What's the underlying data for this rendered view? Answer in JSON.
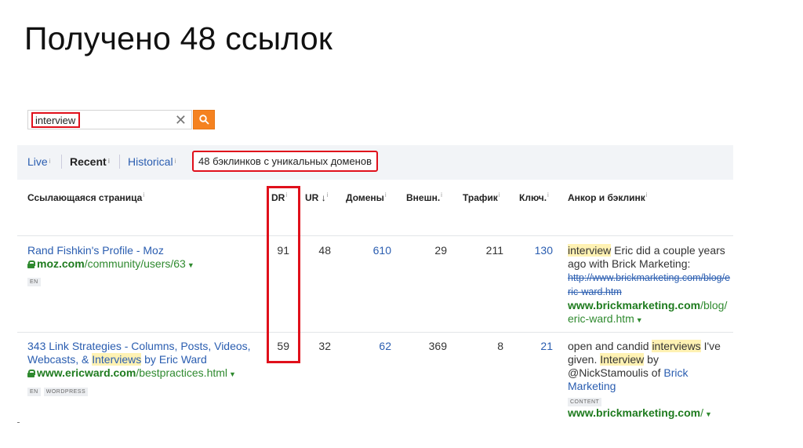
{
  "slide": {
    "title": "Получено 48 ссылок"
  },
  "search": {
    "value": "interview",
    "clear_glyph": "✕"
  },
  "tabs": [
    {
      "label": "Live",
      "info": "i"
    },
    {
      "label": "Recent",
      "info": "i"
    },
    {
      "label": "Historical",
      "info": "i"
    }
  ],
  "summary": {
    "text": "48 бэклинков с уникальных доменов"
  },
  "columns": {
    "page": "Ссылающаяся страница",
    "dr": "DR",
    "ur": "UR",
    "domains": "Домены",
    "ext": "Внешн.",
    "traffic": "Трафик",
    "keywords": "Ключ.",
    "anchor": "Анкор и бэклинк",
    "info": "i"
  },
  "rows": [
    {
      "title": "Rand Fishkin's Profile - Moz",
      "url_domain": "moz.com",
      "url_path": "/community/users/63",
      "tags": [
        "EN"
      ],
      "dr": "91",
      "ur": "48",
      "domains": "610",
      "ext": "29",
      "traffic": "211",
      "keywords": "130",
      "anchor_hl": "interview",
      "anchor_rest": " Eric did a couple years ago with Brick Marketing:",
      "old_link": "http://www.brickmarketing.com/blog/eric-ward.htm",
      "backlink_domain": "www.brickmarketing.com",
      "backlink_path": "/blog/eric-ward.htm"
    },
    {
      "title_pre": "343 Link Strategies - Columns, Posts, Videos, Webcasts, & ",
      "title_hl": "Interviews",
      "title_post": " by Eric Ward",
      "url_domain": "www.ericward.com",
      "url_path": "/bestpractices.html",
      "tags": [
        "EN",
        "WORDPRESS"
      ],
      "dr": "59",
      "ur": "32",
      "domains": "62",
      "ext": "369",
      "traffic": "8",
      "keywords": "21",
      "anchor_pre": "open and candid ",
      "anchor_hl1": "interviews",
      "anchor_mid": " I've given. ",
      "anchor_hl2": "Interview",
      "anchor_mid2": " by @NickStamoulis of ",
      "anchor_link": "Brick Marketing",
      "anchor_tag": "CONTENT",
      "backlink_domain": "www.brickmarketing.com",
      "backlink_path": "/"
    }
  ],
  "icons": {
    "search": "search-icon",
    "lock": "lock-icon",
    "clear": "close-icon"
  },
  "colors": {
    "accent_orange": "#f58220",
    "highlight_red": "#e0101b",
    "link_blue": "#2a5db0",
    "url_green": "#2f8a2f"
  }
}
